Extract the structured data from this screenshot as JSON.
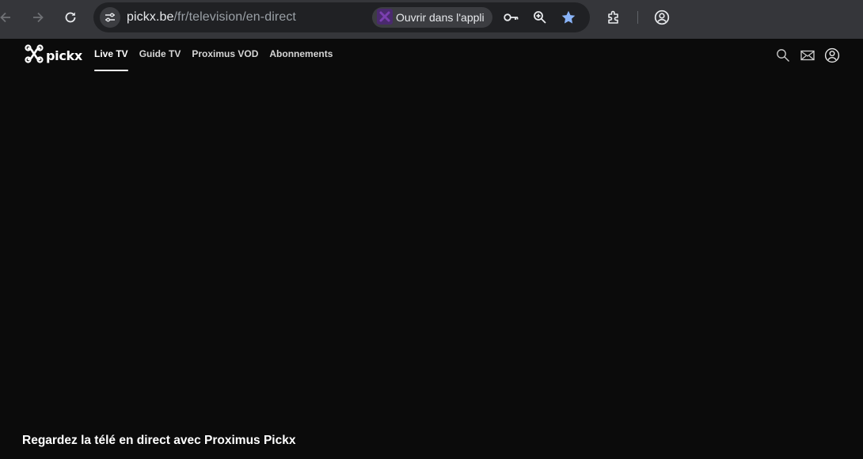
{
  "browser": {
    "url_host": "pickx.be",
    "url_path": "/fr/television/en-direct",
    "open_app_label": "Ouvrir dans l'appli",
    "icons": [
      "back-icon",
      "forward-icon",
      "reload-icon",
      "site-info-icon",
      "pickx-app-icon",
      "key-icon",
      "zoom-icon",
      "bookmark-star-icon",
      "extensions-icon",
      "profile-icon"
    ],
    "star_color": "#8ab4f8"
  },
  "site": {
    "logo_text": "pickx",
    "nav": [
      {
        "label": "Live TV",
        "active": true
      },
      {
        "label": "Guide TV",
        "active": false
      },
      {
        "label": "Proximus VOD",
        "active": false
      },
      {
        "label": "Abonnements",
        "active": false
      }
    ],
    "header_icons": [
      "search-icon",
      "mail-icon",
      "account-icon"
    ]
  },
  "hero": {
    "title": "Regardez la télé en direct avec Proximus Pickx"
  },
  "colors": {
    "page_background": "#0b0b0b",
    "browser_toolbar": "#35363a",
    "omnibox": "#202124",
    "accent_purple": "#5c2d91"
  }
}
